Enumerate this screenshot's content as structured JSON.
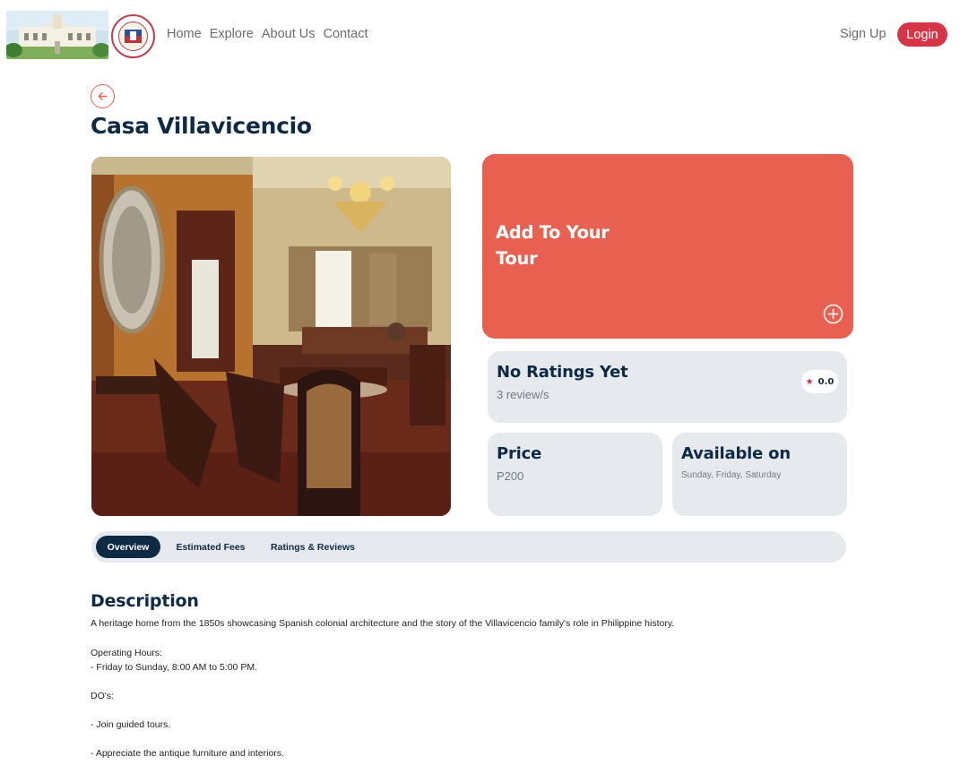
{
  "nav": {
    "links": [
      "Home",
      "Explore",
      "About Us",
      "Contact"
    ],
    "signup_label": "Sign Up",
    "login_label": "Login"
  },
  "page": {
    "title": "Casa Villavicencio"
  },
  "tour_card": {
    "text": "Add To Your Tour",
    "color": "#e8604f"
  },
  "ratings": {
    "heading": "No Ratings Yet",
    "reviews": "3 review/s",
    "score": "0.0"
  },
  "price": {
    "heading": "Price",
    "value": "P200"
  },
  "availability": {
    "heading": "Available on",
    "days": "Sunday, Friday, Saturday"
  },
  "tabs": [
    {
      "label": "Overview",
      "active": true
    },
    {
      "label": "Estimated Fees",
      "active": false
    },
    {
      "label": "Ratings & Reviews",
      "active": false
    }
  ],
  "description": {
    "title": "Description",
    "summary": "A heritage home from the 1850s showcasing Spanish colonial architecture and the story of the Villavicencio family's role in Philippine history.",
    "hours_label": "Operating Hours:",
    "hours": "- Friday to Sunday, 8:00 AM to 5:00 PM.",
    "dos_label": "DO's:",
    "do_1": "- Join guided tours.",
    "do_2": "- Appreciate the antique furniture and interiors."
  },
  "colors": {
    "accent": "#e8604f",
    "login": "#d63447",
    "navy": "#0f2a44",
    "card_bg": "#e6eaee"
  }
}
